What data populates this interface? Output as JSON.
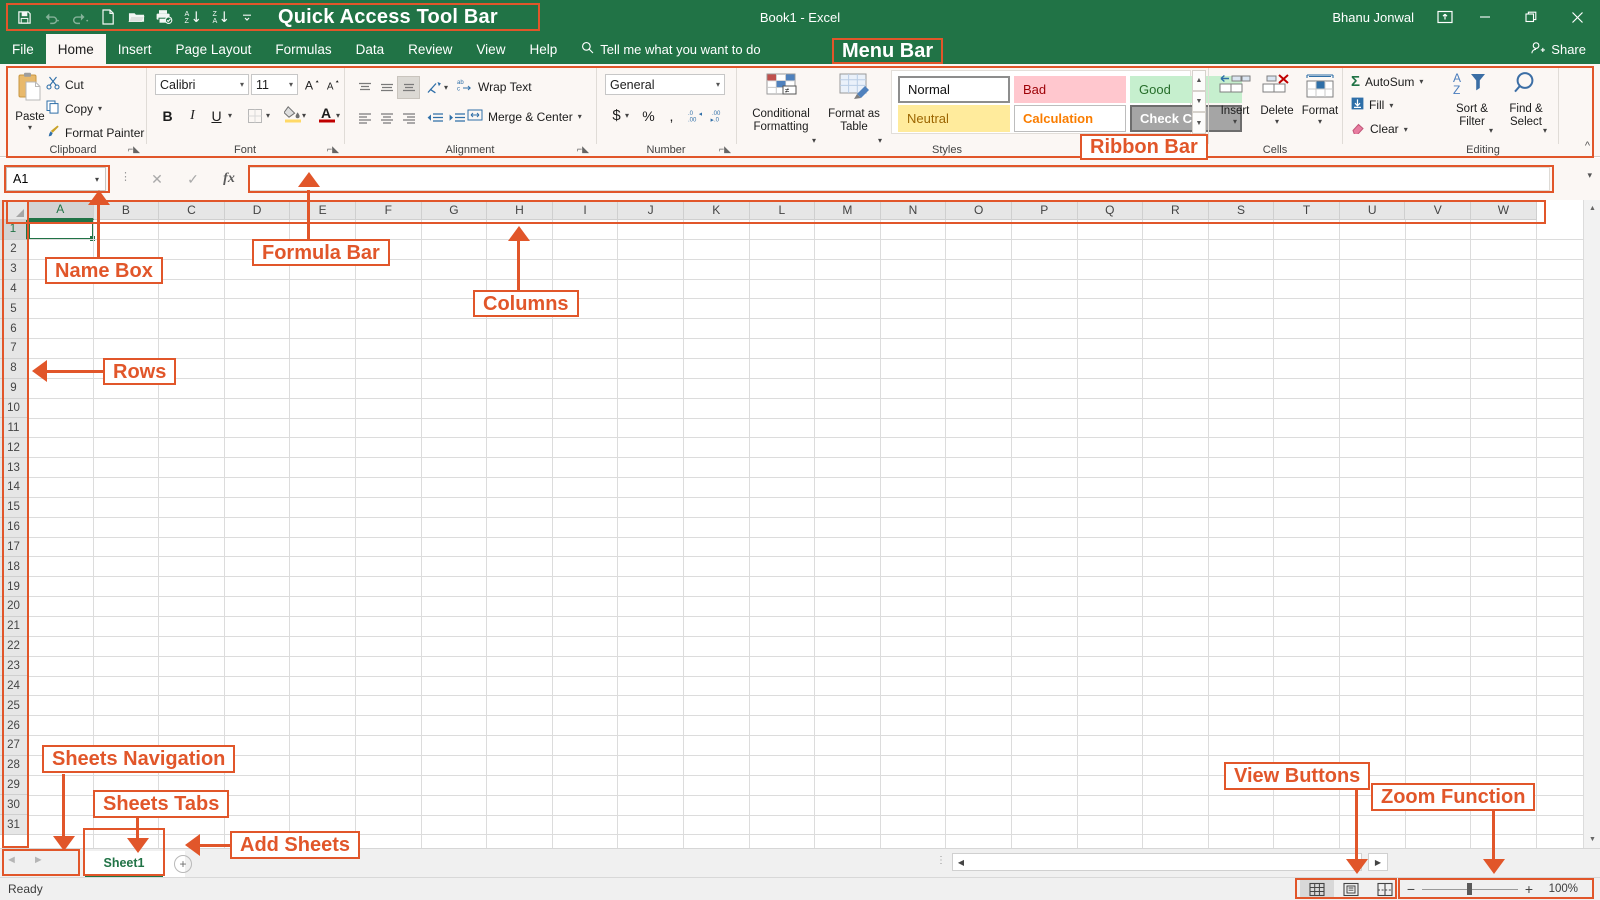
{
  "window": {
    "title": "Book1  -  Excel",
    "user": "Bhanu Jonwal",
    "minimize": "–",
    "restore": "❐",
    "close": "✕",
    "ribbon_display_options": "ribbon-display-icon",
    "share_label": "Share"
  },
  "quick_access": {
    "items": [
      {
        "name": "save-icon",
        "label": "Save"
      },
      {
        "name": "undo-icon",
        "label": "Undo"
      },
      {
        "name": "redo-icon",
        "label": "Redo"
      },
      {
        "name": "new-file-icon",
        "label": "New"
      },
      {
        "name": "open-folder-icon",
        "label": "Open"
      },
      {
        "name": "print-preview-icon",
        "label": "Print Preview and Print"
      },
      {
        "name": "sort-ascending-icon",
        "label": "Sort Ascending"
      },
      {
        "name": "sort-descending-icon",
        "label": "Sort Descending"
      },
      {
        "name": "customize-qat-icon",
        "label": "Customize Quick Access Toolbar"
      }
    ]
  },
  "tabs": {
    "items": [
      {
        "label": "File",
        "active": false
      },
      {
        "label": "Home",
        "active": true
      },
      {
        "label": "Insert",
        "active": false
      },
      {
        "label": "Page Layout",
        "active": false
      },
      {
        "label": "Formulas",
        "active": false
      },
      {
        "label": "Data",
        "active": false
      },
      {
        "label": "Review",
        "active": false
      },
      {
        "label": "View",
        "active": false
      },
      {
        "label": "Help",
        "active": false
      }
    ],
    "tellme": "Tell me what you want to do"
  },
  "ribbon": {
    "clipboard": {
      "label": "Clipboard",
      "paste": "Paste",
      "cut": "Cut",
      "copy": "Copy",
      "format_painter": "Format Painter"
    },
    "font": {
      "label": "Font",
      "family": "Calibri",
      "size": "11",
      "grow": "A",
      "shrink": "A",
      "bold": "B",
      "italic": "I",
      "underline": "U"
    },
    "alignment": {
      "label": "Alignment",
      "wrap_text": "Wrap Text",
      "merge_center": "Merge & Center"
    },
    "number": {
      "label": "Number",
      "format": "General",
      "currency": "$",
      "percent": "%",
      "comma": ","
    },
    "styles": {
      "label": "Styles",
      "conditional_formatting": "Conditional\nFormatting",
      "conditional_formatting_l1": "Conditional",
      "conditional_formatting_l2": "Formatting",
      "format_as_table_l1": "Format as",
      "format_as_table_l2": "Table",
      "cells": [
        "Normal",
        "Bad",
        "Good",
        "Neutral",
        "Calculation",
        "Check Cell"
      ]
    },
    "cells": {
      "label": "Cells",
      "insert": "Insert",
      "delete": "Delete",
      "format": "Format"
    },
    "editing": {
      "label": "Editing",
      "autosum": "AutoSum",
      "fill": "Fill",
      "clear": "Clear",
      "sort_filter_l1": "Sort &",
      "sort_filter_l2": "Filter",
      "find_select_l1": "Find &",
      "find_select_l2": "Select"
    }
  },
  "formula_bar": {
    "name_box": "A1",
    "cancel": "✕",
    "enter": "✓",
    "fx": "fx",
    "value": "",
    "placeholder": ""
  },
  "grid": {
    "columns": [
      "A",
      "B",
      "C",
      "D",
      "E",
      "F",
      "G",
      "H",
      "I",
      "J",
      "K",
      "L",
      "M",
      "N",
      "O",
      "P",
      "Q",
      "R",
      "S",
      "T",
      "U",
      "V",
      "W"
    ],
    "rows": [
      "1",
      "2",
      "3",
      "4",
      "5",
      "6",
      "7",
      "8",
      "9",
      "10",
      "11",
      "12",
      "13",
      "14",
      "15",
      "16",
      "17",
      "18",
      "19",
      "20",
      "21",
      "22",
      "23",
      "24",
      "25",
      "26",
      "27",
      "28",
      "29",
      "30",
      "31"
    ],
    "active_cell": "A1"
  },
  "sheets": {
    "tabs": [
      "Sheet1"
    ],
    "add_label": "+",
    "nav_prev": "◄",
    "nav_next": "►"
  },
  "status": {
    "ready": "Ready",
    "views": [
      {
        "name": "normal-view-icon",
        "label": "Normal",
        "selected": true
      },
      {
        "name": "page-layout-view-icon",
        "label": "Page Layout",
        "selected": false
      },
      {
        "name": "page-break-preview-icon",
        "label": "Page Break Preview",
        "selected": false
      }
    ],
    "zoom_out": "−",
    "zoom_in": "+",
    "zoom_level": "100%"
  },
  "annotations": {
    "quick_access_tool_bar": "Quick Access Tool Bar",
    "menu_bar": "Menu Bar",
    "ribbon_bar": "Ribbon Bar",
    "name_box": "Name Box",
    "formula_bar": "Formula Bar",
    "columns": "Columns",
    "rows": "Rows",
    "sheets_navigation": "Sheets Navigation",
    "sheets_tabs": "Sheets Tabs",
    "add_sheets": "Add Sheets",
    "view_buttons": "View Buttons",
    "zoom_function": "Zoom Function"
  },
  "colors": {
    "brand_green": "#217346",
    "annotation_orange": "#e1562a",
    "ribbon_bg": "#fbf7f4"
  }
}
